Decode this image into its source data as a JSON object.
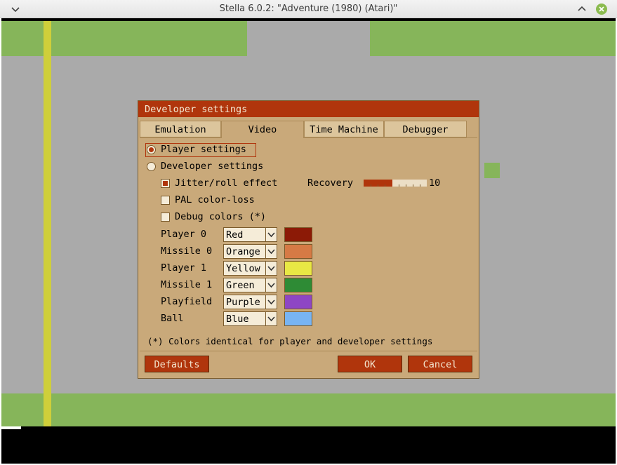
{
  "window": {
    "title": "Stella 6.0.2: \"Adventure (1980) (Atari)\""
  },
  "colors": {
    "accent": "#b0350c",
    "dialog_bg": "#c9a97a",
    "playfield_green": "#86b55a",
    "game_gray": "#aaaaaa",
    "yellow_bar": "#cfcf3a"
  },
  "dialog": {
    "title": "Developer settings",
    "tabs": [
      {
        "label": "Emulation",
        "active": false
      },
      {
        "label": "Video",
        "active": true
      },
      {
        "label": "Time Machine",
        "active": false
      },
      {
        "label": "Debugger",
        "active": false
      }
    ],
    "player_settings_label": "Player settings",
    "developer_settings_label": "Developer settings",
    "jitter_label": "Jitter/roll effect",
    "recovery_label": "Recovery",
    "recovery_value": "10",
    "recovery_fraction": 0.45,
    "pal_label": "PAL color-loss",
    "debug_colors_label": "Debug colors (*)",
    "color_rows": [
      {
        "label": "Player 0",
        "value": "Red",
        "swatch": "#8c1a06"
      },
      {
        "label": "Missile 0",
        "value": "Orange",
        "swatch": "#d67a45"
      },
      {
        "label": "Player 1",
        "value": "Yellow",
        "swatch": "#e8e844"
      },
      {
        "label": "Missile 1",
        "value": "Green",
        "swatch": "#2e8b35"
      },
      {
        "label": "Playfield",
        "value": "Purple",
        "swatch": "#8e46c4"
      },
      {
        "label": "Ball",
        "value": "Blue",
        "swatch": "#78b4f2"
      }
    ],
    "note": "(*) Colors identical for player and developer settings",
    "defaults_label": "Defaults",
    "ok_label": "OK",
    "cancel_label": "Cancel"
  }
}
